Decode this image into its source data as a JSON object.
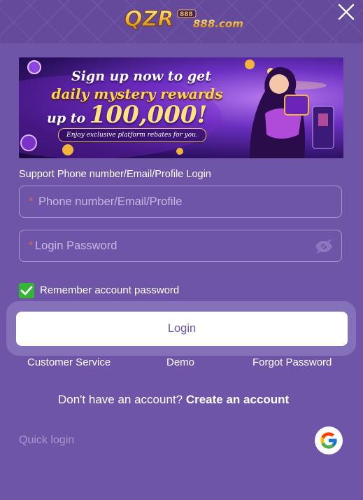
{
  "header": {
    "logo_text": "QZR888.com",
    "close_icon": "close-icon"
  },
  "banner": {
    "line1": "Sign up now to get",
    "line2": "daily mystery rewards",
    "line3_prefix": "up to",
    "line3_amount": "100,000!",
    "subtext": "Enjoy exclusive platform rebates for you."
  },
  "form": {
    "label": "Support Phone number/Email/Profile Login",
    "account_placeholder": "Phone number/Email/Profile",
    "account_required_mark": "*",
    "password_placeholder": "Login Password",
    "password_required_mark": "*",
    "password_toggle_icon": "eye-slash-icon",
    "remember_label": "Remember account password",
    "remember_checked": true,
    "login_button": "Login"
  },
  "links": {
    "customer_service": "Customer Service",
    "demo": "Demo",
    "forgot_password": "Forgot Password"
  },
  "signup": {
    "prompt": "Don't have an account?",
    "link": "Create an account"
  },
  "quick_login": {
    "label": "Quick login",
    "google_icon": "google-icon"
  },
  "colors": {
    "background": "#6f55a8",
    "header": "#654a9c",
    "checkbox": "#35b535",
    "required_mark": "#e0604a",
    "gold": "#ffd54a"
  }
}
